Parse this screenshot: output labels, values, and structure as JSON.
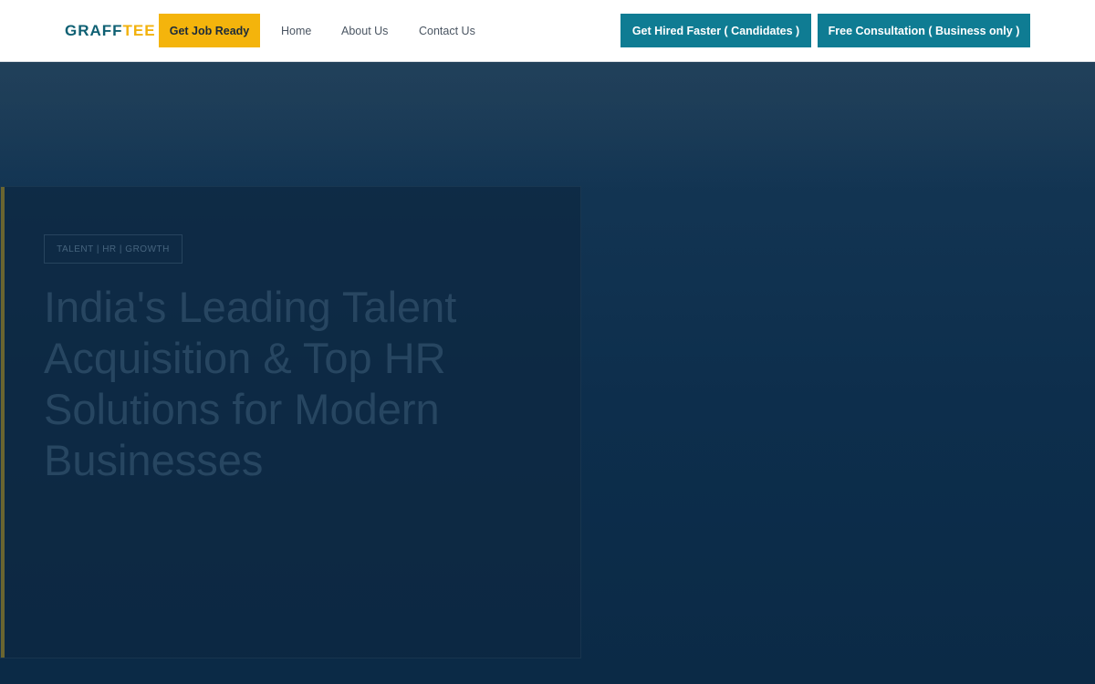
{
  "header": {
    "logo": {
      "part1": "GRAFF",
      "part2": "TEE"
    },
    "job_ready_label": "Get Job Ready",
    "nav": [
      {
        "label": "Home"
      },
      {
        "label": "About Us"
      },
      {
        "label": "Contact Us"
      }
    ],
    "hired_label": "Get Hired Faster ( Candidates )",
    "consult_label": "Free Consultation ( Business only )"
  },
  "hero": {
    "tag": "TALENT | HR | GROWTH",
    "title": "India's Leading Talent Acquisition & Top HR Solutions for Modern Businesses"
  },
  "colors": {
    "brand_teal": "#0f6073",
    "brand_yellow": "#f2b20e",
    "button_teal": "#0f7c93",
    "hero_bg": "#0d2e4c"
  }
}
